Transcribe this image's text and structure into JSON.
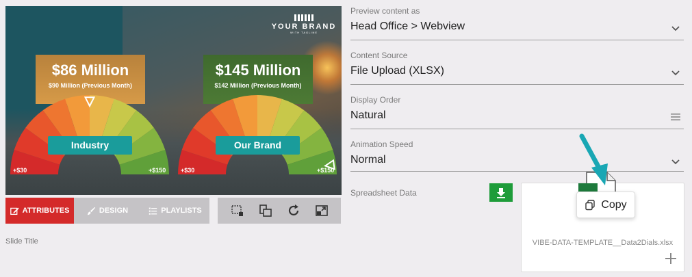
{
  "preview": {
    "brand_name": "YOUR BRAND",
    "brand_tagline": "WITH TAGLINE",
    "cards": [
      {
        "amount": "$86 Million",
        "previous": "$90 Million (Previous Month)",
        "label": "Industry",
        "min": "+$30",
        "max": "+$150",
        "value_fraction": 0.5
      },
      {
        "amount": "$145 Million",
        "previous": "$142 Million (Previous Month)",
        "label": "Our Brand",
        "min": "+$30",
        "max": "+$150",
        "value_fraction": 0.96
      }
    ],
    "gauge_colors": [
      "#d42a2a",
      "#e03a2a",
      "#e8572c",
      "#ee7630",
      "#f29a3a",
      "#e8b64a",
      "#c8c84a",
      "#a8c244",
      "#84b440",
      "#60a03a"
    ]
  },
  "tabs": [
    {
      "label": "ATTRIBUTES",
      "icon": "edit-icon",
      "active": true
    },
    {
      "label": "DESIGN",
      "icon": "brush-icon",
      "active": false
    },
    {
      "label": "PLAYLISTS",
      "icon": "list-icon",
      "active": false
    }
  ],
  "toolbar": {
    "icons": [
      "crop-select-icon",
      "layers-icon",
      "refresh-icon",
      "expand-icon"
    ]
  },
  "slide_title_label": "Slide Title",
  "fields": [
    {
      "label": "Preview content as",
      "value": "Head Office > Webview",
      "icon": "chevron-down-icon"
    },
    {
      "label": "Content Source",
      "value": "File Upload (XLSX)",
      "icon": "chevron-down-icon"
    },
    {
      "label": "Display Order",
      "value": "Natural",
      "icon": "menu-icon"
    },
    {
      "label": "Animation Speed",
      "value": "Normal",
      "icon": "chevron-down-icon"
    }
  ],
  "spreadsheet": {
    "label": "Spreadsheet Data",
    "file_name": "VIBE-DATA-TEMPLATE__Data2Dials.xlsx",
    "copy_label": "Copy"
  },
  "colors": {
    "accent_red": "#d42a2a",
    "teal": "#1a9c9b",
    "green_button": "#1e9c3a",
    "arrow": "#19a7b4"
  }
}
